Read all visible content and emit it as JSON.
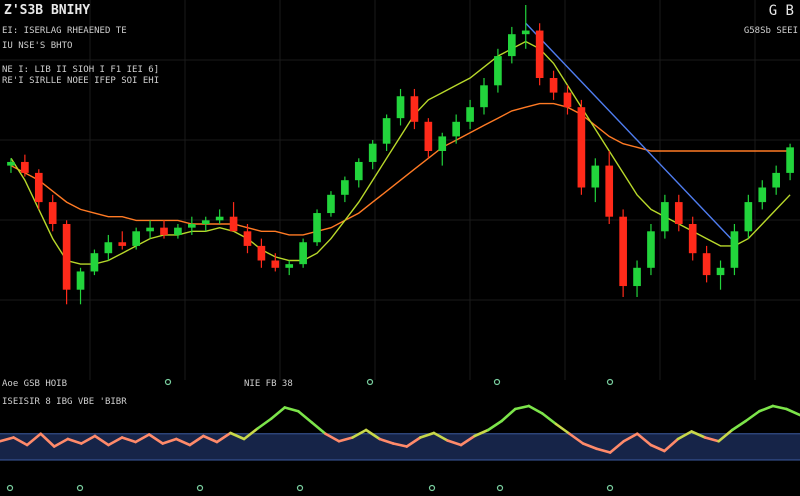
{
  "header": {
    "title_left": "Z'S3B BNIHY",
    "line2": "EI: ISERLAG RHEAENED TE",
    "line3": "IU NSE'S BHTO",
    "line4": "NE I: LIB II SIOH   I F1 IEI 6]",
    "line5": "RE'I SIRLLE NOEE   IFEP SOI EHI",
    "title_right": "G B",
    "subtitle_right": "G58Sb SEEI",
    "osc_label_1": "Aoe GSB HOIB",
    "osc_label_2": "ISEISIR 8 IBG   VBE 'BIBR",
    "mid_label": "NIE FB 38"
  },
  "colors": {
    "background": "#000000",
    "bull": "#22d43c",
    "bear": "#ff2a1a",
    "ma_fast": "#b8d82a",
    "ma_slow": "#ff7a24",
    "trend": "#4f7df0",
    "grid": "#1a1a1a",
    "osc_band": "#1a2a55",
    "osc_line_low": "#ff8a6a",
    "osc_line_high": "#7ce44a",
    "axis_dot": "#7ad0a0"
  },
  "chart_data": [
    {
      "type": "candlestick",
      "title": "",
      "price_range": [
        0,
        100
      ],
      "grid": true,
      "candles": [
        {
          "o": 56,
          "h": 58,
          "l": 54,
          "c": 57
        },
        {
          "o": 57,
          "h": 59,
          "l": 53,
          "c": 54
        },
        {
          "o": 54,
          "h": 55,
          "l": 44,
          "c": 46
        },
        {
          "o": 46,
          "h": 48,
          "l": 38,
          "c": 40
        },
        {
          "o": 40,
          "h": 41,
          "l": 18,
          "c": 22
        },
        {
          "o": 22,
          "h": 28,
          "l": 18,
          "c": 27
        },
        {
          "o": 27,
          "h": 33,
          "l": 26,
          "c": 32
        },
        {
          "o": 32,
          "h": 37,
          "l": 30,
          "c": 35
        },
        {
          "o": 35,
          "h": 38,
          "l": 33,
          "c": 34
        },
        {
          "o": 34,
          "h": 39,
          "l": 33,
          "c": 38
        },
        {
          "o": 38,
          "h": 41,
          "l": 36,
          "c": 39
        },
        {
          "o": 39,
          "h": 41,
          "l": 36,
          "c": 37
        },
        {
          "o": 37,
          "h": 40,
          "l": 36,
          "c": 39
        },
        {
          "o": 39,
          "h": 42,
          "l": 37,
          "c": 40
        },
        {
          "o": 40,
          "h": 42,
          "l": 38,
          "c": 41
        },
        {
          "o": 41,
          "h": 44,
          "l": 40,
          "c": 42
        },
        {
          "o": 42,
          "h": 46,
          "l": 40,
          "c": 38
        },
        {
          "o": 38,
          "h": 40,
          "l": 32,
          "c": 34
        },
        {
          "o": 34,
          "h": 36,
          "l": 28,
          "c": 30
        },
        {
          "o": 30,
          "h": 32,
          "l": 27,
          "c": 28
        },
        {
          "o": 28,
          "h": 30,
          "l": 26,
          "c": 29
        },
        {
          "o": 29,
          "h": 36,
          "l": 28,
          "c": 35
        },
        {
          "o": 35,
          "h": 44,
          "l": 34,
          "c": 43
        },
        {
          "o": 43,
          "h": 49,
          "l": 42,
          "c": 48
        },
        {
          "o": 48,
          "h": 53,
          "l": 46,
          "c": 52
        },
        {
          "o": 52,
          "h": 58,
          "l": 50,
          "c": 57
        },
        {
          "o": 57,
          "h": 63,
          "l": 55,
          "c": 62
        },
        {
          "o": 62,
          "h": 70,
          "l": 60,
          "c": 69
        },
        {
          "o": 69,
          "h": 77,
          "l": 67,
          "c": 75
        },
        {
          "o": 75,
          "h": 77,
          "l": 66,
          "c": 68
        },
        {
          "o": 68,
          "h": 69,
          "l": 58,
          "c": 60
        },
        {
          "o": 60,
          "h": 65,
          "l": 56,
          "c": 64
        },
        {
          "o": 64,
          "h": 70,
          "l": 62,
          "c": 68
        },
        {
          "o": 68,
          "h": 74,
          "l": 66,
          "c": 72
        },
        {
          "o": 72,
          "h": 80,
          "l": 70,
          "c": 78
        },
        {
          "o": 78,
          "h": 88,
          "l": 76,
          "c": 86
        },
        {
          "o": 86,
          "h": 94,
          "l": 84,
          "c": 92
        },
        {
          "o": 92,
          "h": 100,
          "l": 88,
          "c": 93
        },
        {
          "o": 93,
          "h": 95,
          "l": 78,
          "c": 80
        },
        {
          "o": 80,
          "h": 82,
          "l": 74,
          "c": 76
        },
        {
          "o": 76,
          "h": 78,
          "l": 70,
          "c": 72
        },
        {
          "o": 72,
          "h": 74,
          "l": 48,
          "c": 50
        },
        {
          "o": 50,
          "h": 58,
          "l": 46,
          "c": 56
        },
        {
          "o": 56,
          "h": 60,
          "l": 40,
          "c": 42
        },
        {
          "o": 42,
          "h": 44,
          "l": 20,
          "c": 23
        },
        {
          "o": 23,
          "h": 30,
          "l": 20,
          "c": 28
        },
        {
          "o": 28,
          "h": 40,
          "l": 26,
          "c": 38
        },
        {
          "o": 38,
          "h": 48,
          "l": 36,
          "c": 46
        },
        {
          "o": 46,
          "h": 48,
          "l": 38,
          "c": 40
        },
        {
          "o": 40,
          "h": 42,
          "l": 30,
          "c": 32
        },
        {
          "o": 32,
          "h": 34,
          "l": 24,
          "c": 26
        },
        {
          "o": 26,
          "h": 30,
          "l": 22,
          "c": 28
        },
        {
          "o": 28,
          "h": 40,
          "l": 26,
          "c": 38
        },
        {
          "o": 38,
          "h": 48,
          "l": 36,
          "c": 46
        },
        {
          "o": 46,
          "h": 52,
          "l": 44,
          "c": 50
        },
        {
          "o": 50,
          "h": 56,
          "l": 48,
          "c": 54
        },
        {
          "o": 54,
          "h": 62,
          "l": 52,
          "c": 61
        }
      ],
      "ma_fast": [
        58,
        52,
        44,
        36,
        30,
        29,
        29,
        30,
        32,
        34,
        36,
        37,
        37,
        38,
        38,
        39,
        38,
        36,
        33,
        31,
        30,
        30,
        32,
        36,
        41,
        46,
        52,
        58,
        64,
        70,
        74,
        76,
        78,
        80,
        83,
        86,
        88,
        90,
        88,
        84,
        78,
        72,
        66,
        60,
        54,
        48,
        44,
        42,
        40,
        38,
        36,
        34,
        34,
        36,
        40,
        44,
        48
      ],
      "ma_slow": [
        56,
        54,
        52,
        49,
        46,
        44,
        43,
        42,
        42,
        41,
        41,
        41,
        41,
        40,
        40,
        40,
        40,
        39,
        38,
        38,
        37,
        37,
        38,
        39,
        41,
        43,
        46,
        49,
        52,
        55,
        58,
        61,
        63,
        65,
        67,
        69,
        71,
        72,
        73,
        73,
        72,
        70,
        67,
        64,
        62,
        61,
        60,
        60,
        60,
        60,
        60,
        60,
        60,
        60,
        60,
        60,
        60
      ],
      "trend_line": [
        [
          37,
          95
        ],
        [
          52,
          35
        ]
      ]
    },
    {
      "type": "line",
      "title": "",
      "y_range": [
        0,
        100
      ],
      "band": [
        20,
        55
      ],
      "values": [
        45,
        50,
        40,
        55,
        38,
        48,
        42,
        52,
        40,
        50,
        44,
        54,
        42,
        48,
        40,
        52,
        44,
        56,
        48,
        62,
        75,
        90,
        85,
        70,
        55,
        45,
        50,
        60,
        48,
        42,
        38,
        50,
        56,
        46,
        40,
        52,
        60,
        72,
        88,
        92,
        82,
        68,
        55,
        42,
        35,
        30,
        45,
        55,
        40,
        32,
        48,
        58,
        50,
        45,
        60,
        72,
        85,
        92,
        88,
        80
      ]
    }
  ]
}
